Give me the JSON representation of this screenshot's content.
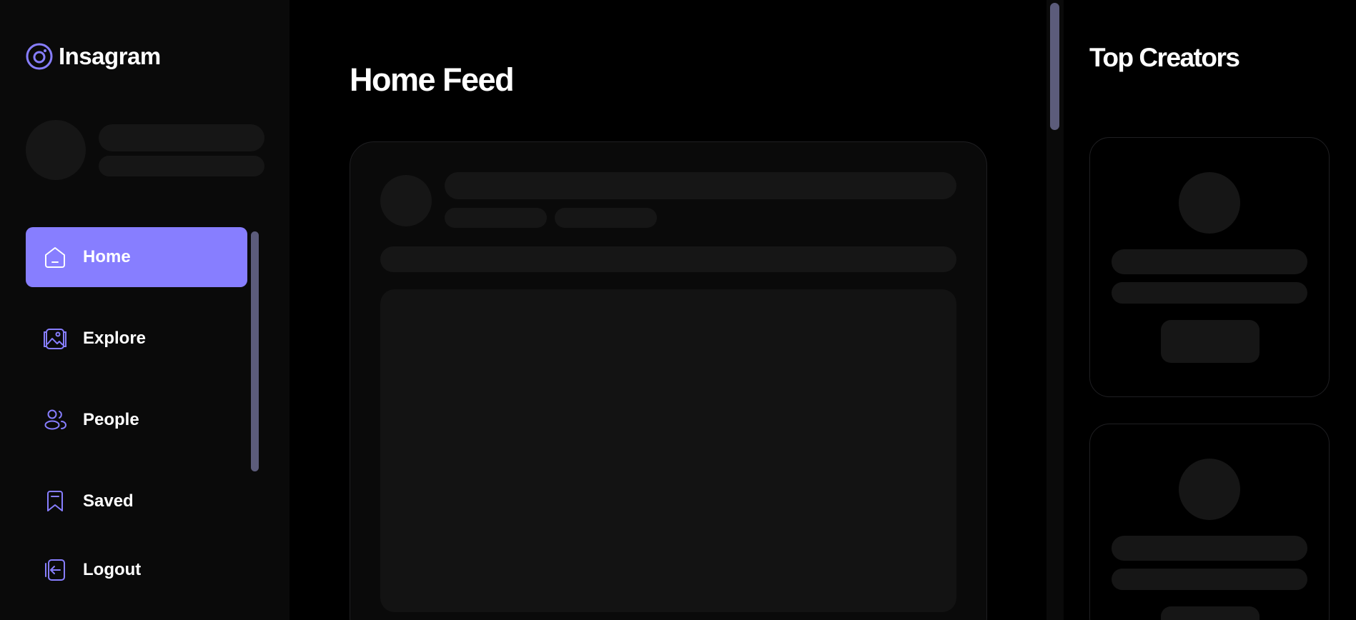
{
  "app": {
    "name": "Insagram",
    "accent": "#877eff"
  },
  "sidebar": {
    "items": [
      {
        "label": "Home",
        "icon": "home-icon",
        "active": true
      },
      {
        "label": "Explore",
        "icon": "gallery-icon",
        "active": false
      },
      {
        "label": "People",
        "icon": "people-icon",
        "active": false
      },
      {
        "label": "Saved",
        "icon": "bookmark-icon",
        "active": false
      }
    ],
    "logout_label": "Logout"
  },
  "main": {
    "title": "Home Feed"
  },
  "right_panel": {
    "title": "Top Creators"
  }
}
